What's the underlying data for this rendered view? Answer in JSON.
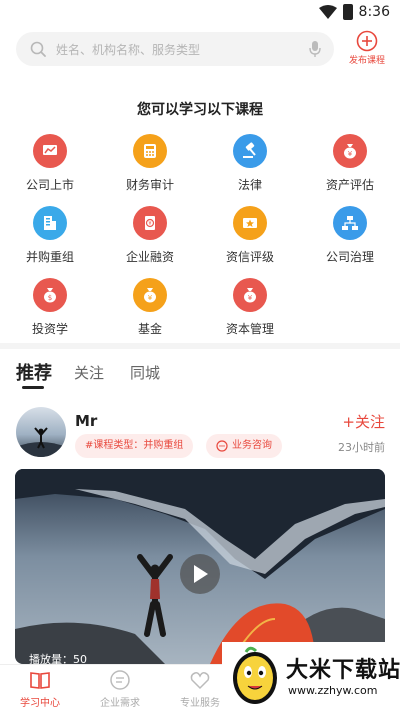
{
  "status_bar": {
    "time": "8:36"
  },
  "search": {
    "placeholder": "姓名、机构名称、服务类型"
  },
  "publish": {
    "label": "发布课程"
  },
  "section_title": "您可以学习以下课程",
  "categories": [
    {
      "label": "公司上市",
      "icon": "chart-icon",
      "color": "#e8584f"
    },
    {
      "label": "财务审计",
      "icon": "calculator-icon",
      "color": "#f5a11a"
    },
    {
      "label": "法律",
      "icon": "gavel-icon",
      "color": "#3a9be9"
    },
    {
      "label": "资产评估",
      "icon": "money-bag-icon",
      "color": "#e8584f"
    },
    {
      "label": "并购重组",
      "icon": "building-icon",
      "color": "#3aa9e9"
    },
    {
      "label": "企业融资",
      "icon": "yen-document-icon",
      "color": "#e8584f"
    },
    {
      "label": "资信评级",
      "icon": "rating-card-icon",
      "color": "#f5a11a"
    },
    {
      "label": "公司治理",
      "icon": "org-chart-icon",
      "color": "#3a9be9"
    },
    {
      "label": "投资学",
      "icon": "coin-bag-icon",
      "color": "#e8584f"
    },
    {
      "label": "基金",
      "icon": "fund-bag-icon",
      "color": "#f5a11a"
    },
    {
      "label": "资本管理",
      "icon": "capital-bag-icon",
      "color": "#e8584f"
    }
  ],
  "tabs": [
    "推荐",
    "关注",
    "同城"
  ],
  "post": {
    "username": "Mr",
    "follow_label": "+关注",
    "tag_type": "#课程类型：并购重组",
    "tag_consult": "业务咨询",
    "time": "23小时前",
    "play_count": "播放量：50"
  },
  "bottom_nav": [
    {
      "label": "学习中心",
      "icon": "book-icon",
      "active": true
    },
    {
      "label": "企业需求",
      "icon": "demand-icon",
      "active": false
    },
    {
      "label": "专业服务",
      "icon": "heart-icon",
      "active": false
    }
  ],
  "watermark": {
    "title": "大米下载站",
    "url": "www.zzhyw.com"
  },
  "colors": {
    "accent": "#e8483d",
    "tag_bg": "#fdeceb"
  }
}
